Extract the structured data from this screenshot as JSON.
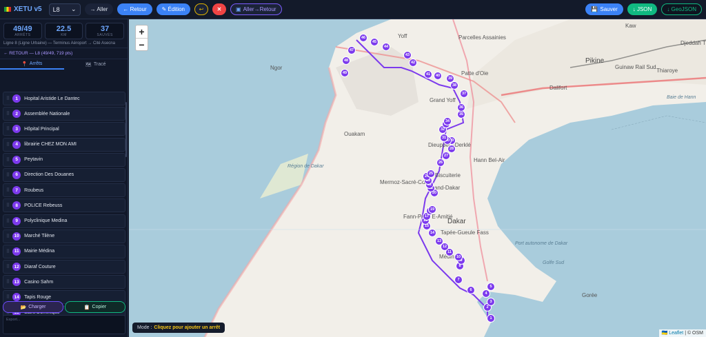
{
  "topbar": {
    "brand": "XETU v5",
    "line_value": "L8",
    "aller": "→ Aller",
    "retour": "← Retour",
    "edition": "✎ Édition",
    "undo": "↩",
    "clear": "✕",
    "aller_retour": "Aller→Retour",
    "save": "Sauver",
    "json": "↓ JSON",
    "geojson": "↓ GeoJSON"
  },
  "stats": [
    {
      "value": "49/49",
      "label": "ARRÊTS"
    },
    {
      "value": "22.5",
      "label": "KM"
    },
    {
      "value": "37",
      "label": "SAUVÉS"
    }
  ],
  "line_description": "Ligne 8 (Ligne Urbaine) — Terminus Aéroport → Cité Asecna",
  "retour_label": "← RETOUR — L8 (49/49, 719 pts)",
  "tabs": [
    {
      "label": "Arrêts",
      "icon": "pin-icon"
    },
    {
      "label": "Tracé",
      "icon": "map-icon"
    }
  ],
  "stops": [
    {
      "n": "1",
      "name": "Hopital Aristide Le Dantec"
    },
    {
      "n": "2",
      "name": "Assemblée Nationale"
    },
    {
      "n": "3",
      "name": "Hôpital Principal"
    },
    {
      "n": "4",
      "name": "librairie CHEZ MON AMI"
    },
    {
      "n": "5",
      "name": "Peytavin"
    },
    {
      "n": "6",
      "name": "Direction Des Douanes"
    },
    {
      "n": "7",
      "name": "Roubeus"
    },
    {
      "n": "8",
      "name": "POLICE Rebeuss"
    },
    {
      "n": "9",
      "name": "Polyclinique Medina"
    },
    {
      "n": "10",
      "name": "Marché Tilène"
    },
    {
      "n": "11",
      "name": "Mairie Médina"
    },
    {
      "n": "12",
      "name": "Diaraf Couture"
    },
    {
      "n": "13",
      "name": "Casino Sahm"
    },
    {
      "n": "14",
      "name": "Tapis Rouge"
    },
    {
      "n": "15",
      "name": "Saint Dominique"
    }
  ],
  "buttons": {
    "charger": "Charger",
    "copier": "Copier"
  },
  "export_placeholder": "Export...",
  "map": {
    "mode_label": "Mode :",
    "mode_value": "Cliquez pour ajouter un arrêt",
    "zoom_in": "+",
    "zoom_out": "−",
    "attribution_leaflet": "Leaflet",
    "attribution_osm": "| © OSM",
    "places": [
      "Yoff",
      "Parcelles Assainies",
      "Ngor",
      "Patte d'Oie",
      "Pikine",
      "Guinaw Rail Sud",
      "Thiaroye",
      "Dalifort",
      "Grand Yoff",
      "Ouakam",
      "Dieuppeul-Derklé",
      "Hann Bel-Air",
      "Biscuiterie",
      "Mermoz-Sacré-Cœur",
      "Grand-Dakar",
      "Fann-Point E-Amitié",
      "Dakar",
      "Tapée-Gueule Fass",
      "Médina",
      "Gorée",
      "Baie de Hann",
      "Kaw",
      "Port autonome de Dakar",
      "Région de Dakar",
      "Golfe Sud",
      "Djeddah Thiaroye Kao"
    ],
    "markers": [
      "1",
      "2",
      "3",
      "4",
      "5",
      "6",
      "7",
      "8",
      "9",
      "10",
      "11",
      "12",
      "13",
      "14",
      "15",
      "16",
      "17",
      "18",
      "19",
      "20",
      "21",
      "22",
      "23",
      "24",
      "25",
      "26",
      "27",
      "28",
      "29",
      "30",
      "31",
      "32",
      "33",
      "34",
      "35",
      "36",
      "37",
      "38",
      "39",
      "40",
      "41",
      "42",
      "43",
      "44",
      "45",
      "46",
      "47",
      "48",
      "49"
    ]
  }
}
